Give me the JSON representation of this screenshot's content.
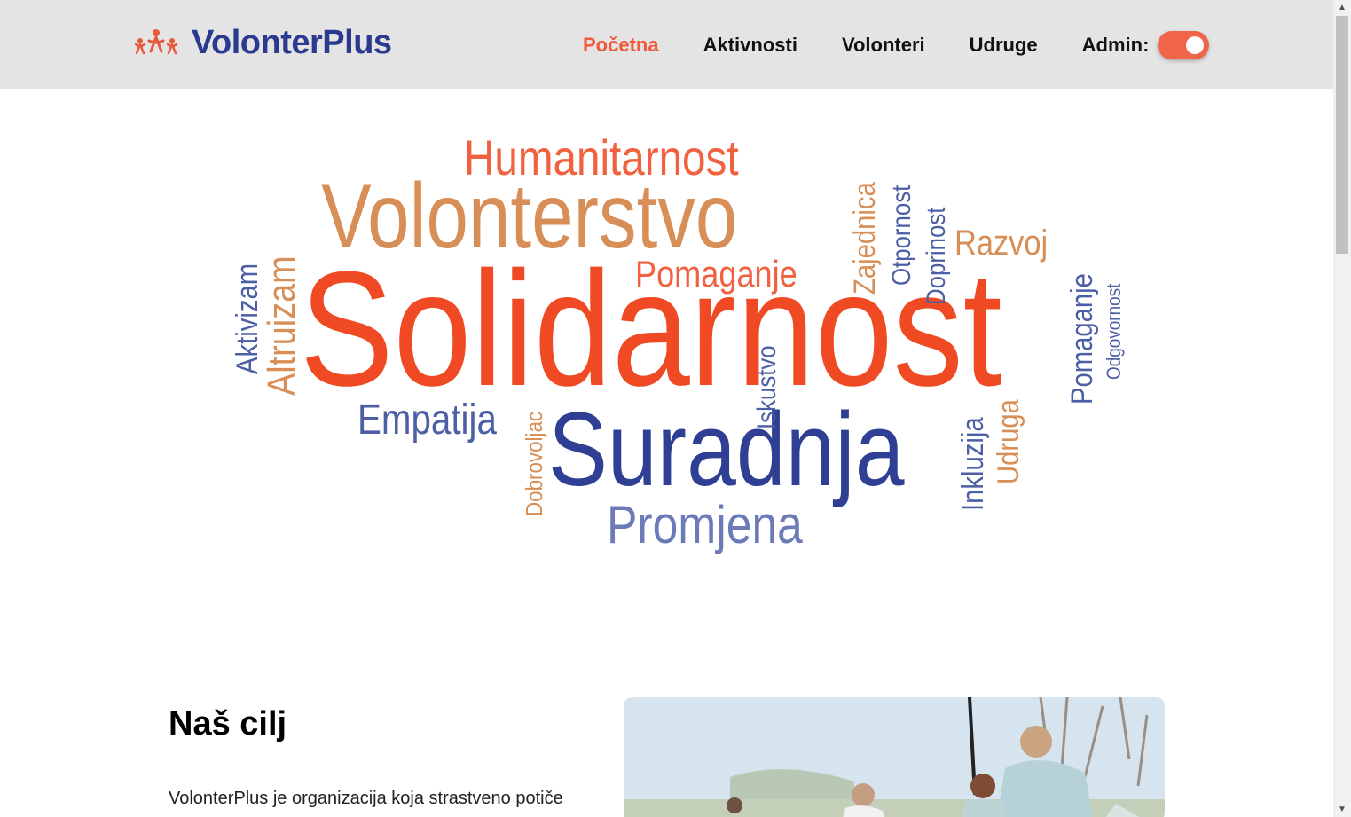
{
  "brand": {
    "name": "VolonterPlus",
    "logo_icon": "three-people-icon"
  },
  "nav": {
    "items": [
      {
        "label": "Početna",
        "active": true
      },
      {
        "label": "Aktivnosti",
        "active": false
      },
      {
        "label": "Volonteri",
        "active": false
      },
      {
        "label": "Udruge",
        "active": false
      }
    ],
    "admin_label": "Admin:",
    "admin_toggle_on": true
  },
  "word_cloud": {
    "words": [
      "Humanitarnost",
      "Volonterstvo",
      "Solidarnost",
      "Suradnja",
      "Promjena",
      "Empatija",
      "Pomaganje",
      "Aktivizam",
      "Altruizam",
      "Zajednica",
      "Otpornost",
      "Doprinost",
      "Razvoj",
      "Pomaganje",
      "Odgovornost",
      "Iskustvo",
      "Dobrovoljac",
      "Inkluzija",
      "Udruga"
    ]
  },
  "section": {
    "title": "Naš cilj",
    "text": "VolonterPlus je organizacija koja strastveno potiče"
  },
  "colors": {
    "accent": "#f05a3a",
    "brand_navy": "#2b3a8f",
    "header_bg": "#e4e4e4"
  }
}
